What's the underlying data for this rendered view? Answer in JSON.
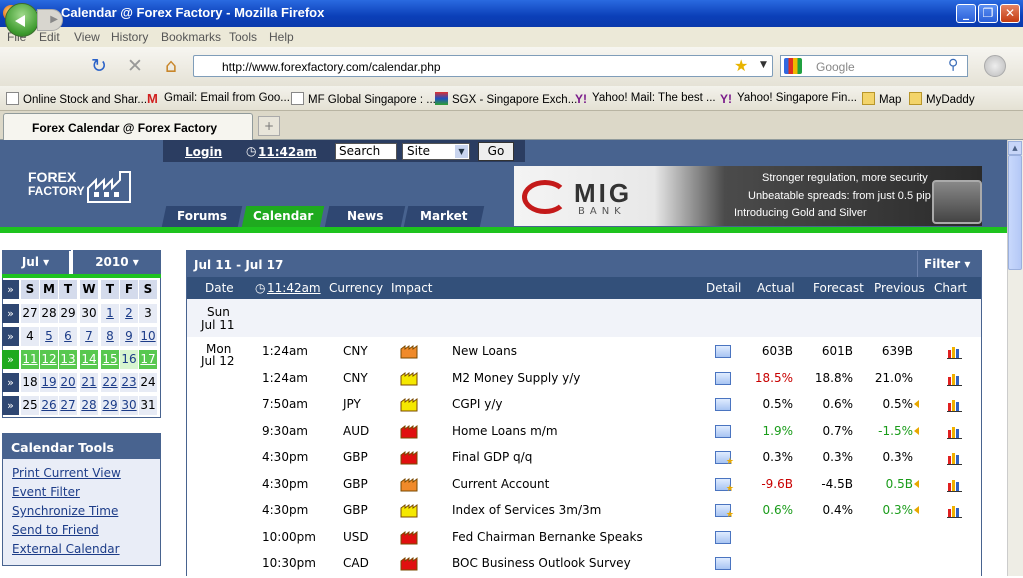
{
  "window": {
    "title": "Forex Calendar @ Forex Factory - Mozilla Firefox"
  },
  "menu": [
    "File",
    "Edit",
    "View",
    "History",
    "Bookmarks",
    "Tools",
    "Help"
  ],
  "nav": {
    "url": "http://www.forexfactory.com/calendar.php",
    "search_placeholder": "Google"
  },
  "bookmarks": [
    "Online Stock and Shar...",
    "Gmail: Email from Goo...",
    "MF Global Singapore : ...",
    "SGX - Singapore Exch...",
    "Yahoo! Mail: The best ...",
    "Yahoo! Singapore Fin...",
    "Map",
    "MyDaddy"
  ],
  "tabs": [
    {
      "label": "Forex Calendar @ Forex Factory"
    }
  ],
  "site": {
    "login": "Login",
    "time": "11:42am",
    "search_value": "Search",
    "search_scope": "Site",
    "go": "Go",
    "logo_line1": "FOREX",
    "logo_line2": "FACTORY",
    "nav": [
      "Forums",
      "Calendar",
      "News",
      "Market"
    ],
    "banner": {
      "brand": "MIG",
      "brand_sub": "BANK",
      "lines": [
        "Stronger regulation, more security",
        "Unbeatable spreads: from just 0.5 pip",
        "Introducing Gold and Silver"
      ]
    }
  },
  "minical": {
    "month": "Jul",
    "year": "2010",
    "dow": [
      "S",
      "M",
      "T",
      "W",
      "T",
      "F",
      "S"
    ],
    "weeks": [
      [
        "27",
        "28",
        "29",
        "30",
        "1",
        "2",
        "3"
      ],
      [
        "4",
        "5",
        "6",
        "7",
        "8",
        "9",
        "10"
      ],
      [
        "11",
        "12",
        "13",
        "14",
        "15",
        "16",
        "17"
      ],
      [
        "18",
        "19",
        "20",
        "21",
        "22",
        "23",
        "24"
      ],
      [
        "25",
        "26",
        "27",
        "28",
        "29",
        "30",
        "31"
      ]
    ]
  },
  "tools": {
    "title": "Calendar Tools",
    "links": [
      "Print Current View",
      "Event Filter",
      "Synchronize Time",
      "Send to Friend",
      "External Calendar"
    ]
  },
  "calendar": {
    "range": "Jul 11 - Jul 17",
    "filter": "Filter",
    "columns": {
      "date": "Date",
      "time": "11:42am",
      "currency": "Currency",
      "impact": "Impact",
      "detail": "Detail",
      "actual": "Actual",
      "forecast": "Forecast",
      "previous": "Previous",
      "chart": "Chart"
    },
    "days": [
      {
        "dow": "Sun",
        "date": "Jul 11"
      },
      {
        "dow": "Mon",
        "date": "Jul 12"
      }
    ],
    "events": [
      {
        "time": "1:24am",
        "currency": "CNY",
        "impact": "orange",
        "event": "New Loans",
        "actual": "603B",
        "forecast": "601B",
        "previous": "639B",
        "actual_color": "black",
        "previous_color": "black",
        "revised": false,
        "detail_star": false
      },
      {
        "time": "1:24am",
        "currency": "CNY",
        "impact": "yellow",
        "event": "M2 Money Supply y/y",
        "actual": "18.5%",
        "forecast": "18.8%",
        "previous": "21.0%",
        "actual_color": "red",
        "previous_color": "black",
        "revised": false,
        "detail_star": false
      },
      {
        "time": "7:50am",
        "currency": "JPY",
        "impact": "yellow",
        "event": "CGPI y/y",
        "actual": "0.5%",
        "forecast": "0.6%",
        "previous": "0.5%",
        "actual_color": "black",
        "previous_color": "black",
        "revised": true,
        "detail_star": false
      },
      {
        "time": "9:30am",
        "currency": "AUD",
        "impact": "red",
        "event": "Home Loans m/m",
        "actual": "1.9%",
        "forecast": "0.7%",
        "previous": "-1.5%",
        "actual_color": "green",
        "previous_color": "green",
        "revised": true,
        "detail_star": false
      },
      {
        "time": "4:30pm",
        "currency": "GBP",
        "impact": "red",
        "event": "Final GDP q/q",
        "actual": "0.3%",
        "forecast": "0.3%",
        "previous": "0.3%",
        "actual_color": "black",
        "previous_color": "black",
        "revised": false,
        "detail_star": true
      },
      {
        "time": "4:30pm",
        "currency": "GBP",
        "impact": "orange",
        "event": "Current Account",
        "actual": "-9.6B",
        "forecast": "-4.5B",
        "previous": "0.5B",
        "actual_color": "red",
        "previous_color": "green",
        "revised": true,
        "detail_star": true
      },
      {
        "time": "4:30pm",
        "currency": "GBP",
        "impact": "yellow",
        "event": "Index of Services 3m/3m",
        "actual": "0.6%",
        "forecast": "0.4%",
        "previous": "0.3%",
        "actual_color": "green",
        "previous_color": "green",
        "revised": true,
        "detail_star": true
      },
      {
        "time": "10:00pm",
        "currency": "USD",
        "impact": "red",
        "event": "Fed Chairman Bernanke Speaks",
        "actual": "",
        "forecast": "",
        "previous": "",
        "actual_color": "black",
        "previous_color": "black",
        "revised": false,
        "detail_star": false
      },
      {
        "time": "10:30pm",
        "currency": "CAD",
        "impact": "red",
        "event": "BOC Business Outlook Survey",
        "actual": "",
        "forecast": "",
        "previous": "",
        "actual_color": "black",
        "previous_color": "black",
        "revised": false,
        "detail_star": false
      }
    ]
  },
  "colors": {
    "header_blue": "#48638f",
    "accent_green": "#1ec31e",
    "impact_red": "#e01010",
    "impact_orange": "#f08a2a",
    "impact_yellow": "#f5e800"
  }
}
